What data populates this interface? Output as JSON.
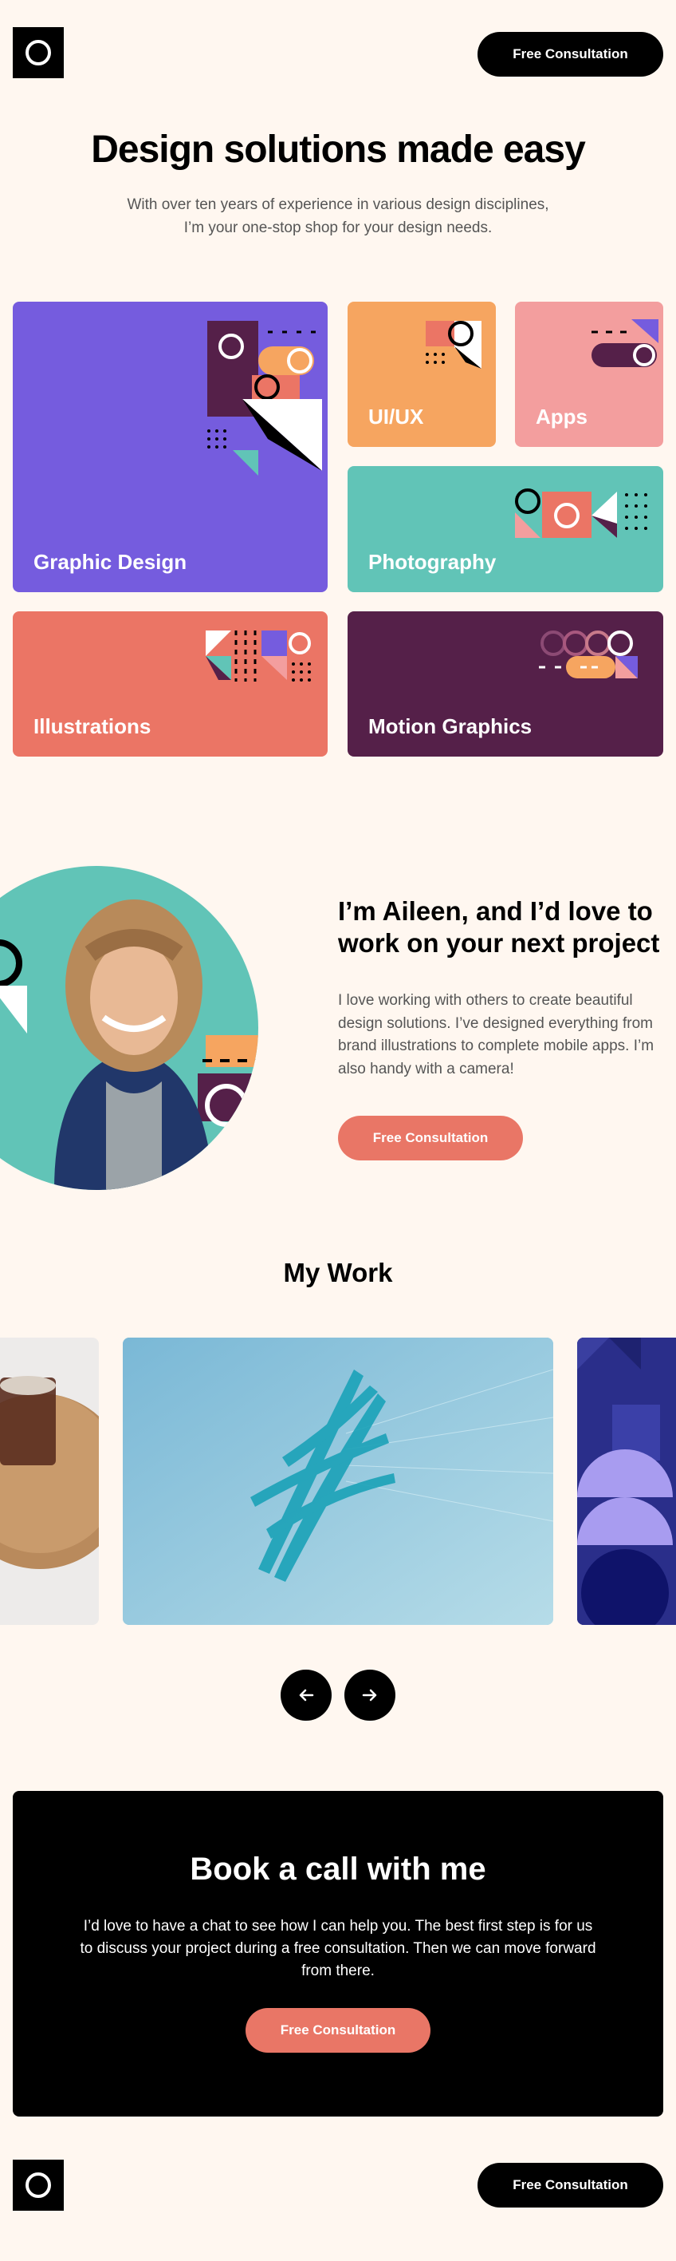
{
  "header": {
    "cta_label": "Free Consultation"
  },
  "hero": {
    "title": "Design solutions made easy",
    "subtitle": "With over ten years of experience in various design disciplines, I’m your one-stop shop for your design needs."
  },
  "services": [
    {
      "label": "Graphic Design",
      "color": "#755CDE"
    },
    {
      "label": "UI/UX",
      "color": "#F6A560"
    },
    {
      "label": "Apps",
      "color": "#F39E9E"
    },
    {
      "label": "Photography",
      "color": "#61C4B7"
    },
    {
      "label": "Illustrations",
      "color": "#EB7565"
    },
    {
      "label": "Motion Graphics",
      "color": "#552049"
    }
  ],
  "about": {
    "title": "I’m Aileen, and I’d love to work on your next project",
    "text": "I love working with others to create beautiful design solutions. I’ve designed everything from brand illustrations to complete mobile apps. I’m also handy with a camera!",
    "cta_label": "Free Consultation"
  },
  "work": {
    "title": "My Work"
  },
  "cta": {
    "title": "Book a call with me",
    "text": "I’d love to have a chat to see how I can help you. The best first step is for us to discuss your project during a free consultation. Then we can move forward from there.",
    "cta_label": "Free Consultation"
  },
  "footer": {
    "cta_label": "Free Consultation"
  },
  "icons": {
    "prev": "arrow-left-icon",
    "next": "arrow-right-icon",
    "logo": "circle-logo-icon"
  }
}
